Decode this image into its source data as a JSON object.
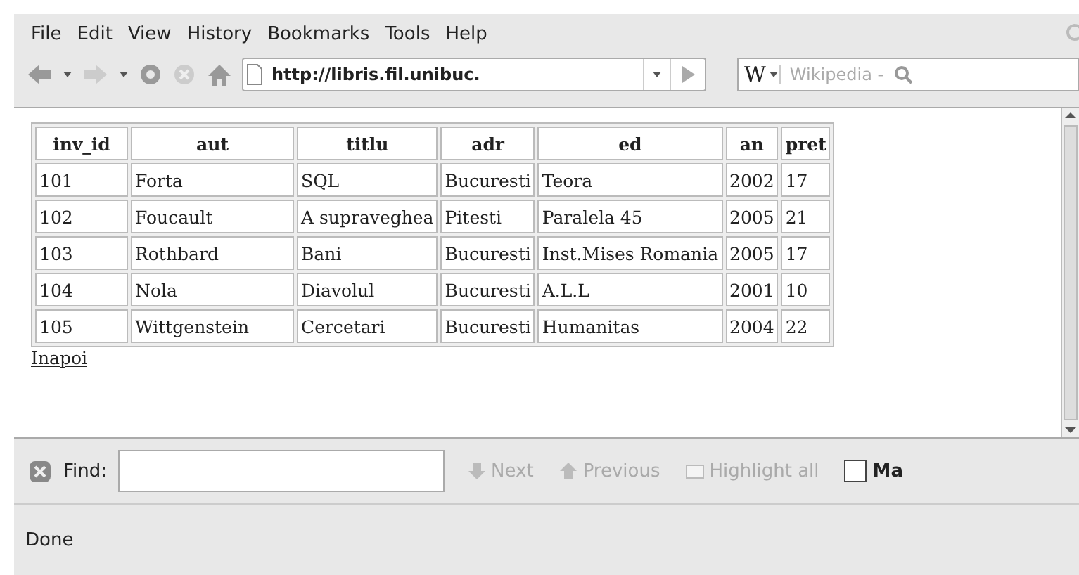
{
  "menu": [
    "File",
    "Edit",
    "View",
    "History",
    "Bookmarks",
    "Tools",
    "Help"
  ],
  "toolbar": {
    "url": "http://libris.fil.unibuc.",
    "search_engine": "W",
    "search_placeholder": "Wikipedia -"
  },
  "table": {
    "columns": [
      "inv_id",
      "aut",
      "titlu",
      "adr",
      "ed",
      "an",
      "pret"
    ],
    "rows": [
      [
        "101",
        "Forta",
        "SQL",
        "Bucuresti",
        "Teora",
        "2002",
        "17"
      ],
      [
        "102",
        "Foucault",
        "A supraveghea",
        "Pitesti",
        "Paralela 45",
        "2005",
        "21"
      ],
      [
        "103",
        "Rothbard",
        "Bani",
        "Bucuresti",
        "Inst.Mises Romania",
        "2005",
        "17"
      ],
      [
        "104",
        "Nola",
        "Diavolul",
        "Bucuresti",
        "A.L.L",
        "2001",
        "10"
      ],
      [
        "105",
        "Wittgenstein",
        "Cercetari",
        "Bucuresti",
        "Humanitas",
        "2004",
        "22"
      ]
    ]
  },
  "link": "Inapoi",
  "find_bar": {
    "label": "Find:",
    "buttons": [
      {
        "kind": "down",
        "label": "Next",
        "disabled": true
      },
      {
        "kind": "up",
        "label": "Previous",
        "disabled": true
      },
      {
        "kind": "highlight",
        "label": "Highlight all",
        "disabled": true
      }
    ],
    "checkbox": {
      "label": "Ma",
      "checked": false
    }
  },
  "status_bar": "Done"
}
